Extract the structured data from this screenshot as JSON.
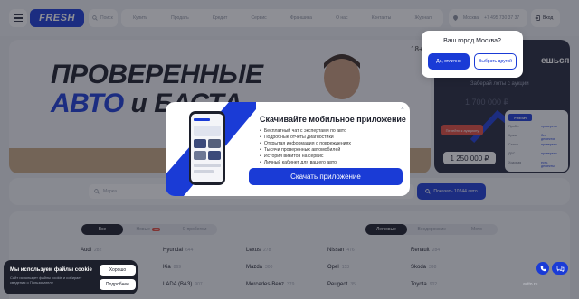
{
  "header": {
    "logo": "FRESH",
    "search_label": "Поиск",
    "nav": [
      "Купить",
      "Продать",
      "Кредит",
      "Сервис",
      "Франшиза",
      "О нас",
      "Контакты",
      "Журнал"
    ],
    "city": "Москва",
    "phone": "+7 495 730 37 37",
    "login": "Вход"
  },
  "hero": {
    "line1": "ПРОВЕРЕННЫЕ",
    "line2_blue": "АВТО",
    "line2_dark": " и БАСТА",
    "age": "18+"
  },
  "promo": {
    "headline": "ешься",
    "subtitle": "Заберай лоты с аукции",
    "price_top": "1 700 000 ₽",
    "card_logo": "FRESH",
    "card_rows": [
      {
        "label": "Пробег",
        "value": "проверено"
      },
      {
        "label": "Кузов",
        "value": "без дефектов"
      },
      {
        "label": "Салон",
        "value": "проверено"
      },
      {
        "label": "ДВС",
        "value": "проверено"
      },
      {
        "label": "Ходовая",
        "value": "есть дефекты"
      }
    ],
    "button": "Перейти к аукциону",
    "price_bottom": "1 250 000 ₽"
  },
  "city_popup": {
    "question": "Ваш город Москва?",
    "yes": "Да, отлично",
    "other": "Выбрать другой"
  },
  "filter": {
    "placeholder": "Марка",
    "show_button": "Показать 10244 авто"
  },
  "catalog": {
    "tabs_left": [
      {
        "label": "Все",
        "active": true
      },
      {
        "label": "Новые",
        "badge": "new",
        "active": false
      },
      {
        "label": "С пробегом",
        "active": false
      }
    ],
    "tabs_right": [
      {
        "label": "Легковые",
        "active": true
      },
      {
        "label": "Внедорожник",
        "active": false
      },
      {
        "label": "Мото",
        "active": false
      }
    ],
    "brands": [
      {
        "name": "Audi",
        "count": "282"
      },
      {
        "name": "Hyundai",
        "count": "644"
      },
      {
        "name": "Lexus",
        "count": "278"
      },
      {
        "name": "Nissan",
        "count": "476"
      },
      {
        "name": "Renault",
        "count": "284"
      },
      {
        "name": "Kia",
        "count": "869"
      },
      {
        "name": "Mazda",
        "count": "300"
      },
      {
        "name": "Opel",
        "count": "153"
      },
      {
        "name": "Skoda",
        "count": "398"
      },
      {
        "name": "LADA (ВАЗ)",
        "count": "907"
      },
      {
        "name": "Mercedes-Benz",
        "count": "379"
      },
      {
        "name": "Peugeot",
        "count": "35"
      },
      {
        "name": "Toyota",
        "count": "902"
      }
    ]
  },
  "modal": {
    "title": "Скачивайте мобильное приложение",
    "features": [
      "Бесплатный чат с экспертами по авто",
      "Подробные отчеты диагностики",
      "Открытая информация о повреждениях",
      "Тысячи проверенных автомобилей",
      "История визитов на сервис",
      "Личный кабинет для вашего авто"
    ],
    "button": "Скачать приложение",
    "close": "×"
  },
  "cookie": {
    "title": "Мы используем файлы cookie",
    "text": "Сайт использует файлы cookie и собирает сведения о Пользователе",
    "ok": "Хорошо",
    "more": "Подробнее"
  },
  "watermark": "avito.ru"
}
